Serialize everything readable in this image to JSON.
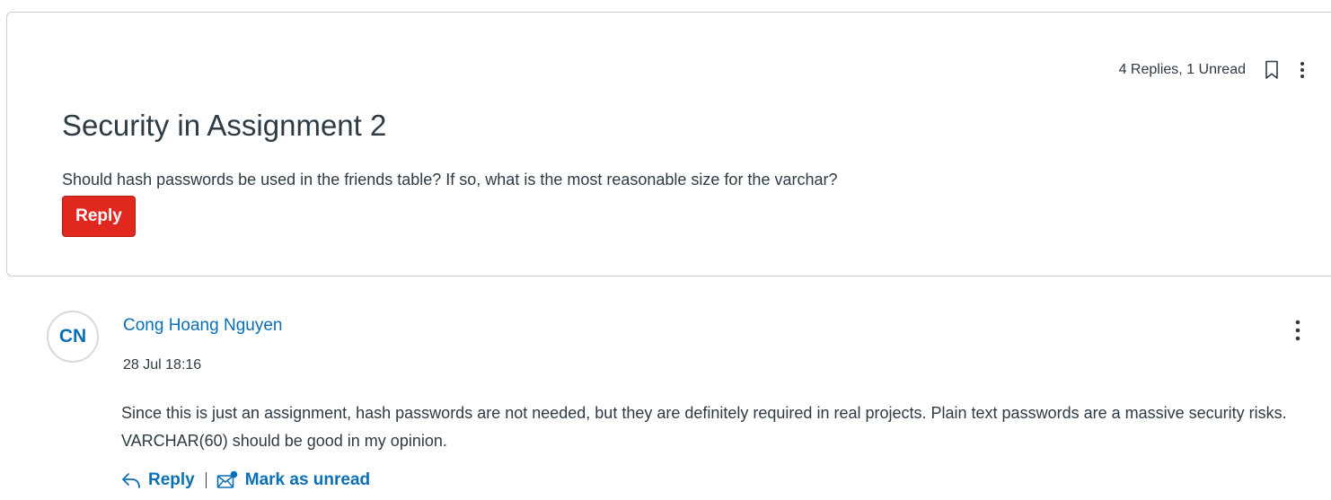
{
  "topic": {
    "reply_summary": "4 Replies, 1 Unread",
    "title": "Security in Assignment 2",
    "body": "Should hash passwords be used in the friends table? If so, what is the most reasonable size for the varchar?",
    "reply_label": "Reply",
    "icons": {
      "bookmark": "bookmark-icon",
      "options": "kebab-menu-icon"
    }
  },
  "entry": {
    "avatar_initials": "CN",
    "author": "Cong Hoang Nguyen",
    "timestamp": "28 Jul 18:16",
    "message": "Since this is just an assignment, hash passwords are not needed, but they are definitely required in real projects. Plain text passwords are a massive security risks. VARCHAR(60) should be good in my opinion.",
    "actions": {
      "reply_label": "Reply",
      "separator": "|",
      "mark_unread_label": "Mark as unread"
    },
    "icons": {
      "reply": "reply-arrow-icon",
      "mark_unread": "mail-unread-icon",
      "options": "kebab-menu-icon"
    }
  },
  "colors": {
    "primary_button": "#e0281f",
    "link": "#0a6fb5",
    "text": "#2d3b45",
    "border": "#c7cdd1"
  }
}
